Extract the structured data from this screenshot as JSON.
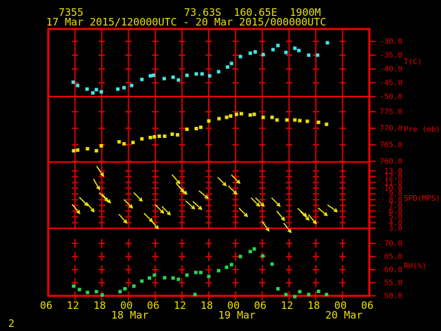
{
  "header": {
    "station_id": "7355",
    "location": "73.63S  160.65E  1900M",
    "period": "17 Mar 2015/120000UTC - 20 Mar 2015/000000UTC"
  },
  "footer": {
    "page_number": "2"
  },
  "colors": {
    "background": "#000000",
    "frame_red": "#f20000",
    "grid_red": "#d40000",
    "red_text": "#e60000",
    "yellow": "#e8e000",
    "temp_cyan": "#45e6e6",
    "pressure_yellow": "#e8e00a",
    "wind_yellow": "#f0e616",
    "rh_green": "#2fd24f"
  },
  "chart_data": {
    "type": "meteogram",
    "x_axis": {
      "start": "17 Mar 2015 06UTC",
      "end": "20 Mar 2015 06UTC",
      "hours_span": 72,
      "tick_interval_hours": 6,
      "tick_labels": [
        "06",
        "12",
        "18",
        "00",
        "06",
        "12",
        "18",
        "00",
        "06",
        "12",
        "18",
        "00",
        "06"
      ],
      "date_labels": [
        {
          "text": "18 Mar",
          "tick_index": 3
        },
        {
          "text": "19 Mar",
          "tick_index": 7
        },
        {
          "text": "20 Mar",
          "tick_index": 11
        }
      ]
    },
    "panels": [
      {
        "type": "scatter",
        "ylabel": "T(C)",
        "color_key": "temp_cyan",
        "ytick_labels": [
          "-30.0",
          "-35.0",
          "-40.0",
          "-45.0",
          "-50.0"
        ],
        "points": [
          [
            5.6,
            -44.8
          ],
          [
            6.6,
            -46.0
          ],
          [
            8.7,
            -47.3
          ],
          [
            10.0,
            -48.7
          ],
          [
            10.8,
            -47.5
          ],
          [
            11.9,
            -48.3
          ],
          [
            15.6,
            -47.3
          ],
          [
            17.0,
            -46.8
          ],
          [
            18.7,
            -46.0
          ],
          [
            21.0,
            -43.8
          ],
          [
            22.9,
            -42.5
          ],
          [
            23.6,
            -42.3
          ],
          [
            26.0,
            -43.5
          ],
          [
            28.0,
            -43.0
          ],
          [
            29.2,
            -44.0
          ],
          [
            31.1,
            -42.3
          ],
          [
            33.2,
            -41.8
          ],
          [
            34.5,
            -41.8
          ],
          [
            36.2,
            -42.5
          ],
          [
            38.2,
            -41.0
          ],
          [
            40.2,
            -39.3
          ],
          [
            41.1,
            -38.0
          ],
          [
            43.1,
            -35.5
          ],
          [
            45.3,
            -34.3
          ],
          [
            46.4,
            -33.8
          ],
          [
            48.2,
            -34.8
          ],
          [
            50.4,
            -33.0
          ],
          [
            51.5,
            -31.5
          ],
          [
            53.3,
            -34.0
          ],
          [
            55.3,
            -32.5
          ],
          [
            56.2,
            -33.3
          ],
          [
            58.4,
            -35.0
          ],
          [
            60.4,
            -35.0
          ],
          [
            62.6,
            -30.5
          ]
        ]
      },
      {
        "type": "scatter",
        "ylabel": "Pre (mb)",
        "color_key": "pressure_yellow",
        "ytick_labels": [
          "775.0",
          "770.0",
          "765.0",
          "760.0"
        ],
        "points": [
          [
            5.7,
            763.2
          ],
          [
            6.6,
            763.4
          ],
          [
            8.8,
            763.8
          ],
          [
            10.8,
            763.2
          ],
          [
            11.9,
            764.7
          ],
          [
            15.9,
            765.9
          ],
          [
            17.0,
            765.3
          ],
          [
            19.0,
            765.7
          ],
          [
            21.0,
            766.8
          ],
          [
            22.9,
            767.2
          ],
          [
            23.8,
            767.4
          ],
          [
            24.9,
            767.6
          ],
          [
            26.1,
            767.6
          ],
          [
            27.8,
            768.2
          ],
          [
            29.0,
            768.0
          ],
          [
            31.1,
            769.7
          ],
          [
            33.2,
            769.9
          ],
          [
            34.2,
            770.3
          ],
          [
            36.0,
            772.2
          ],
          [
            38.3,
            772.9
          ],
          [
            40.0,
            773.3
          ],
          [
            40.9,
            773.7
          ],
          [
            42.2,
            774.2
          ],
          [
            43.3,
            774.4
          ],
          [
            45.3,
            774.0
          ],
          [
            46.2,
            774.2
          ],
          [
            48.2,
            773.3
          ],
          [
            50.2,
            773.3
          ],
          [
            51.3,
            772.5
          ],
          [
            53.5,
            772.5
          ],
          [
            55.3,
            772.5
          ],
          [
            56.4,
            772.3
          ],
          [
            58.1,
            772.1
          ],
          [
            60.6,
            771.8
          ],
          [
            62.4,
            771.2
          ]
        ]
      },
      {
        "type": "wind-arrows",
        "ylabel": "SPD(MPS)",
        "color_key": "wind_yellow",
        "ytick_labels": [
          "13.0",
          "12.0",
          "11.0",
          "10.0",
          "9.0",
          "8.0",
          "7.0",
          "6.0",
          "5.0",
          "4.0",
          "3.0"
        ],
        "points": [
          [
            6.2,
            6.4,
            50
          ],
          [
            7.9,
            7.7,
            45
          ],
          [
            9.4,
            6.7,
            50
          ],
          [
            10.8,
            10.7,
            60
          ],
          [
            11.6,
            13.0,
            55
          ],
          [
            12.4,
            8.5,
            45
          ],
          [
            13.0,
            8.2,
            45
          ],
          [
            16.7,
            4.7,
            48
          ],
          [
            17.9,
            7.3,
            45
          ],
          [
            20.1,
            8.5,
            45
          ],
          [
            22.4,
            4.9,
            45
          ],
          [
            23.8,
            3.7,
            50
          ],
          [
            24.9,
            6.4,
            45
          ],
          [
            26.4,
            6.1,
            45
          ],
          [
            28.6,
            11.6,
            50
          ],
          [
            29.5,
            10.1,
            50
          ],
          [
            30.1,
            9.7,
            45
          ],
          [
            31.8,
            7.1,
            42
          ],
          [
            33.4,
            7.0,
            42
          ],
          [
            34.8,
            8.9,
            40
          ],
          [
            38.9,
            11.2,
            45
          ],
          [
            41.3,
            9.7,
            45
          ],
          [
            42.0,
            11.6,
            45
          ],
          [
            43.7,
            5.8,
            45
          ],
          [
            46.4,
            7.6,
            45
          ],
          [
            47.4,
            7.6,
            45
          ],
          [
            48.7,
            3.4,
            55
          ],
          [
            51.0,
            7.6,
            45
          ],
          [
            52.1,
            5.2,
            50
          ],
          [
            53.6,
            3.1,
            52
          ],
          [
            56.9,
            5.8,
            42
          ],
          [
            57.5,
            5.2,
            45
          ],
          [
            59.2,
            4.6,
            50
          ],
          [
            61.5,
            5.9,
            40
          ],
          [
            63.7,
            6.5,
            35
          ]
        ]
      },
      {
        "type": "scatter",
        "ylabel": "RH(%)",
        "color_key": "rh_green",
        "ytick_labels": [
          "70.0",
          "65.0",
          "60.0",
          "55.0",
          "50.0"
        ],
        "points": [
          [
            5.7,
            53.7
          ],
          [
            7.0,
            52.4
          ],
          [
            8.8,
            51.3
          ],
          [
            10.8,
            51.6
          ],
          [
            12.1,
            50.3
          ],
          [
            16.1,
            51.6
          ],
          [
            17.2,
            52.7
          ],
          [
            19.2,
            53.7
          ],
          [
            21.0,
            55.6
          ],
          [
            22.7,
            56.8
          ],
          [
            23.8,
            57.9
          ],
          [
            26.1,
            56.9
          ],
          [
            28.0,
            56.8
          ],
          [
            29.2,
            56.3
          ],
          [
            31.1,
            57.9
          ],
          [
            32.9,
            50.5
          ],
          [
            33.1,
            58.9
          ],
          [
            34.2,
            58.9
          ],
          [
            36.0,
            57.4
          ],
          [
            38.2,
            59.6
          ],
          [
            40.0,
            60.9
          ],
          [
            41.1,
            61.9
          ],
          [
            43.1,
            65.0
          ],
          [
            45.3,
            66.9
          ],
          [
            46.2,
            67.9
          ],
          [
            48.1,
            65.2
          ],
          [
            50.2,
            62.1
          ],
          [
            51.5,
            52.7
          ],
          [
            53.3,
            50.5
          ],
          [
            55.3,
            49.7
          ],
          [
            56.4,
            51.6
          ],
          [
            58.4,
            50.5
          ],
          [
            60.6,
            51.7
          ],
          [
            62.4,
            50.5
          ]
        ]
      }
    ]
  }
}
